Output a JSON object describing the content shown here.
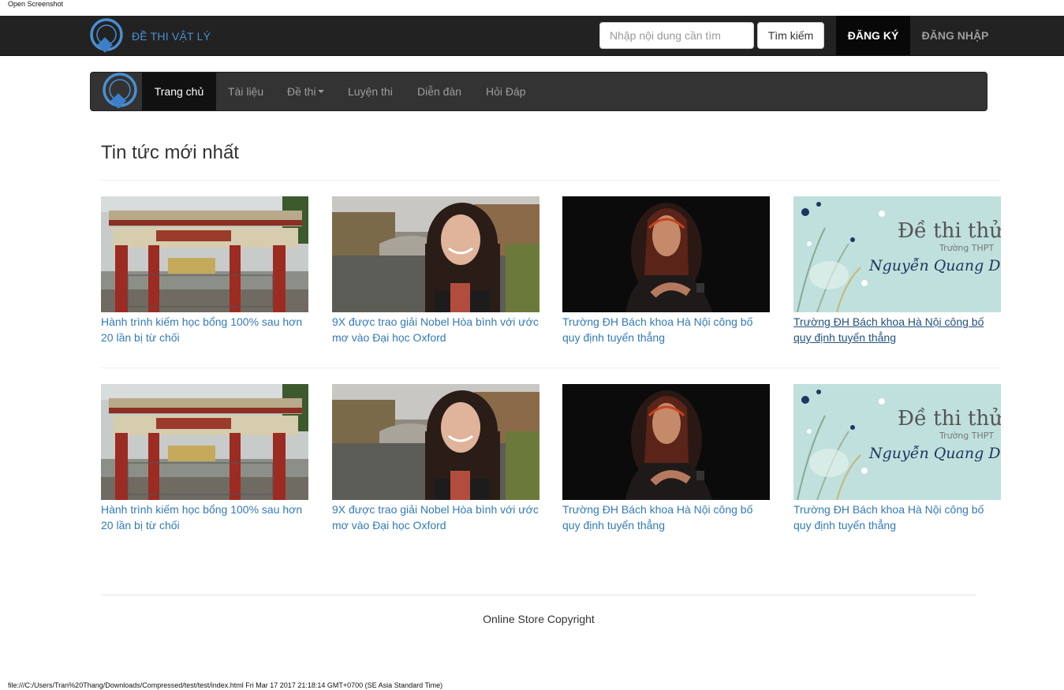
{
  "print_header": "Open Screenshot",
  "topbar": {
    "brand": "ĐỀ THI VẬT LÝ",
    "search_placeholder": "Nhập nội dung cần tìm",
    "search_button": "Tìm kiếm",
    "register": "ĐĂNG KÝ",
    "login": "ĐĂNG NHẬP"
  },
  "nav": {
    "items": [
      {
        "label": "Trang chủ",
        "active": true
      },
      {
        "label": "Tài liệu"
      },
      {
        "label": "Đề thi",
        "dropdown": true
      },
      {
        "label": "Luyện thi"
      },
      {
        "label": "Diễn đàn"
      },
      {
        "label": "Hỏi Đáp"
      }
    ]
  },
  "main": {
    "section_title": "Tin tức mới nhất",
    "rows": [
      [
        {
          "image": "school-gate-photo",
          "title": "Hành trình kiếm học bổng 100% sau hơn 20 lần bị từ chối"
        },
        {
          "image": "girl-at-bridge-photo",
          "title": "9X được trao giải Nobel Hòa bình với ước mơ vào Đại học Oxford"
        },
        {
          "image": "woman-in-headscarf-photo",
          "title": "Trường ĐH Bách khoa Hà Nội công bố quy định tuyển thẳng"
        },
        {
          "image": "exam-poster-image",
          "title": "Trường ĐH Bách khoa Hà Nội công bố quy định tuyển thẳng",
          "hover": true
        }
      ],
      [
        {
          "image": "school-gate-photo",
          "title": "Hành trình kiếm học bổng 100% sau hơn 20 lần bị từ chối"
        },
        {
          "image": "girl-at-bridge-photo",
          "title": "9X được trao giải Nobel Hòa bình với ước mơ vào Đại học Oxford"
        },
        {
          "image": "woman-in-headscarf-photo",
          "title": "Trường ĐH Bách khoa Hà Nội công bố quy định tuyển thẳng"
        },
        {
          "image": "exam-poster-image",
          "title": "Trường ĐH Bách khoa Hà Nội công bố quy định tuyển thẳng"
        }
      ]
    ],
    "poster": {
      "line1": "Đề thi thử",
      "line2": "Trường THPT",
      "line3": "Nguyễn Quang Diệu"
    }
  },
  "footer": {
    "copyright": "Online Store Copyright"
  },
  "print_footer": "file:///C:/Users/Tran%20Thang/Downloads/Compressed/test/test/index.html Fri Mar 17 2017 21:18:14 GMT+0700 (SE Asia Standard Time)",
  "colors": {
    "topbar": "#222222",
    "nav": "#333333",
    "link": "#337ab7",
    "brand": "#4a8fd0"
  }
}
